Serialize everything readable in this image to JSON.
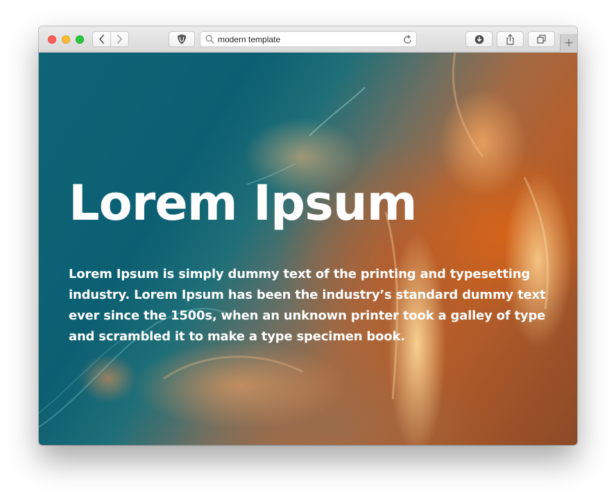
{
  "browser": {
    "url_text": "modern template",
    "new_tab_label": "+",
    "icons": {
      "back": "chevron-left-icon",
      "forward": "chevron-right-icon",
      "extension": "ublock-shield-icon",
      "search": "search-icon",
      "reload": "reload-icon",
      "downloads": "download-icon",
      "share": "share-icon",
      "tabs": "tabs-overview-icon"
    }
  },
  "hero": {
    "title": "Lorem Ipsum",
    "body": "Lorem Ipsum is simply dummy text of the printing and typesetting industry. Lorem Ipsum has been the industry’s standard dummy text ever since the 1500s, when an unknown printer took a galley of type and scrambled it to make a type specimen book."
  },
  "colors": {
    "traffic_close": "#fe5f57",
    "traffic_minimize": "#febc2e",
    "traffic_maximize": "#28c840",
    "hero_text": "#ffffff",
    "water": "#0c5f72",
    "sand": "#d9661b"
  }
}
